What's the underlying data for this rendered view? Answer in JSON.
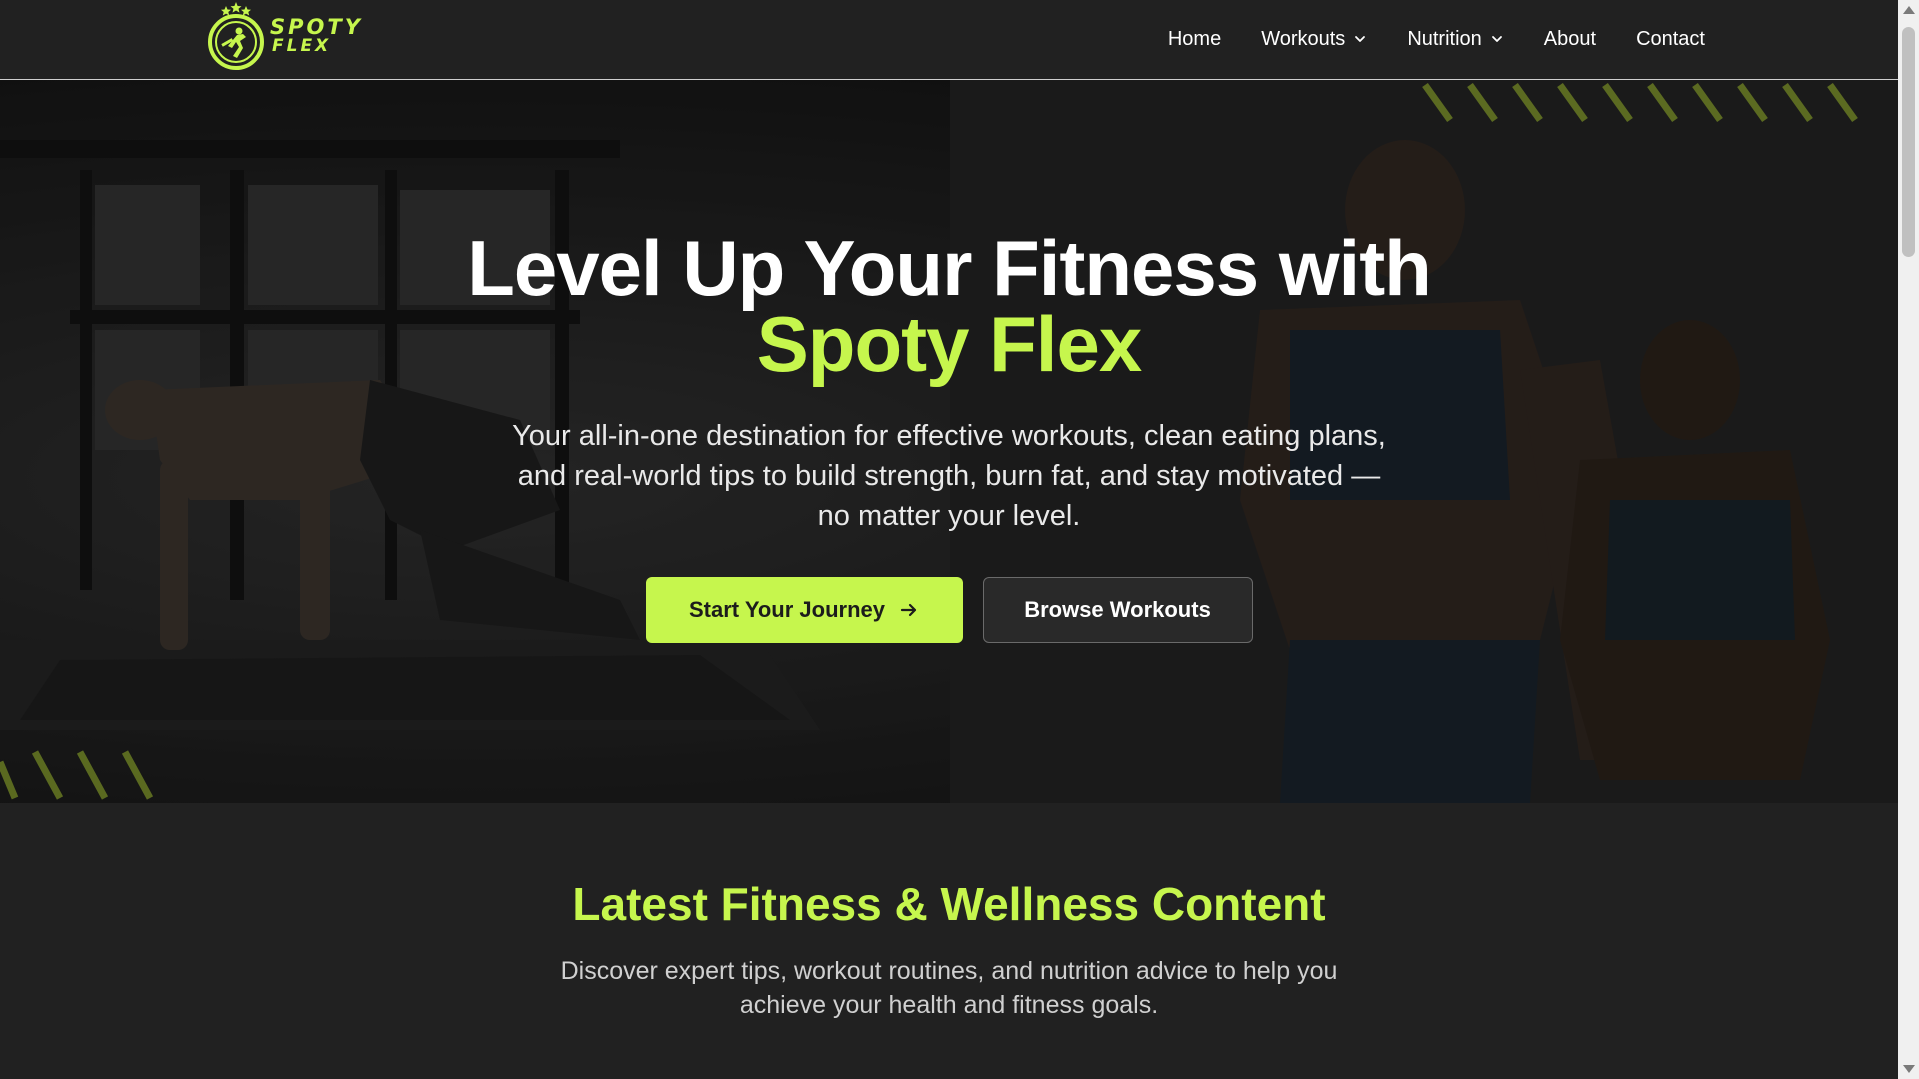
{
  "colors": {
    "accent": "#c6f64d",
    "background": "#212121",
    "text": "#ffffff"
  },
  "brand": {
    "line1": "SPOTY",
    "line2": "FLEX"
  },
  "nav": {
    "items": [
      {
        "label": "Home",
        "dropdown": false
      },
      {
        "label": "Workouts",
        "dropdown": true
      },
      {
        "label": "Nutrition",
        "dropdown": true
      },
      {
        "label": "About",
        "dropdown": false
      },
      {
        "label": "Contact",
        "dropdown": false
      }
    ]
  },
  "hero": {
    "title_line1": "Level Up Your Fitness with",
    "title_accent": "Spoty Flex",
    "subtitle": "Your all-in-one destination for effective workouts, clean eating plans, and real-world tips to build strength, burn fat, and stay motivated — no matter your level.",
    "primary_button": "Start Your Journey",
    "primary_button_icon": "arrow-right-icon",
    "secondary_button": "Browse Workouts"
  },
  "content_section": {
    "title": "Latest Fitness & Wellness Content",
    "subtitle": "Discover expert tips, workout routines, and nutrition advice to help you achieve your health and fitness goals."
  }
}
